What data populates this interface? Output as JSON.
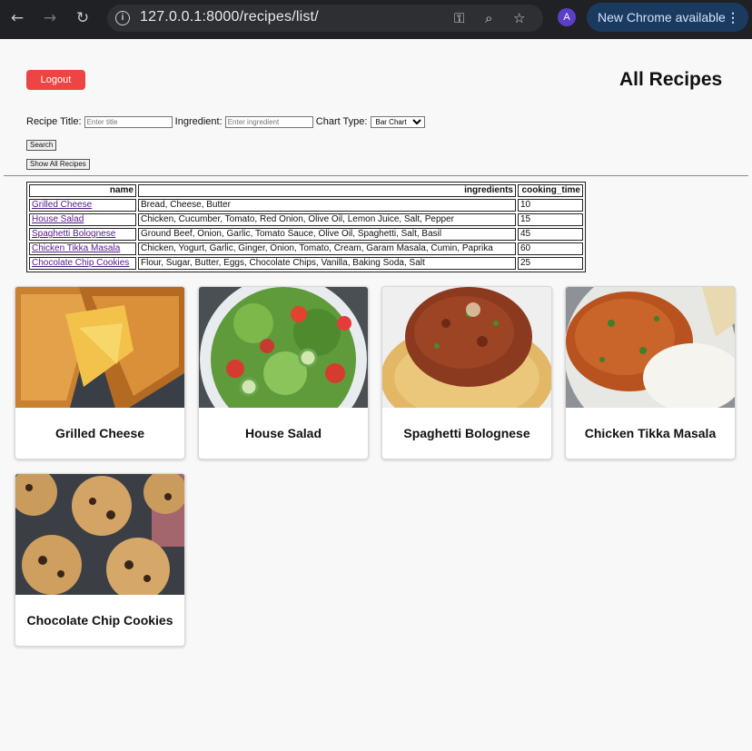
{
  "browser": {
    "url": "127.0.0.1:8000/recipes/list/",
    "avatar_letter": "A",
    "update_label": "New Chrome available",
    "back_icon": "arrow-left-icon",
    "forward_icon": "arrow-right-icon",
    "reload_icon": "reload-icon",
    "info_icon": "info-icon",
    "password_icon": "key-icon",
    "zoom_icon": "zoom-icon",
    "bookmark_icon": "star-icon",
    "menu_icon": "kebab-menu-icon"
  },
  "header": {
    "logout_label": "Logout",
    "title": "All Recipes",
    "logout_color": "#ef4444"
  },
  "search": {
    "title_label": "Recipe Title:",
    "title_placeholder": "Enter title",
    "ingredient_label": "Ingredient:",
    "ingredient_placeholder": "Enter ingredient",
    "chart_label": "Chart Type:",
    "chart_selected": "Bar Chart",
    "search_button": "Search",
    "show_all_button": "Show All Recipes"
  },
  "table": {
    "columns": [
      "name",
      "ingredients",
      "cooking_time"
    ],
    "rows": [
      {
        "name": "Grilled Cheese",
        "ingredients": "Bread, Cheese, Butter",
        "cooking_time": "10"
      },
      {
        "name": "House Salad",
        "ingredients": "Chicken, Cucumber, Tomato, Red Onion, Olive Oil, Lemon Juice, Salt, Pepper",
        "cooking_time": "15"
      },
      {
        "name": "Spaghetti Bolognese",
        "ingredients": "Ground Beef, Onion, Garlic, Tomato Sauce, Olive Oil, Spaghetti, Salt, Basil",
        "cooking_time": "45"
      },
      {
        "name": "Chicken Tikka Masala",
        "ingredients": "Chicken, Yogurt, Garlic, Ginger, Onion, Tomato, Cream, Garam Masala, Cumin, Paprika",
        "cooking_time": "60"
      },
      {
        "name": "Chocolate Chip Cookies",
        "ingredients": "Flour, Sugar, Butter, Eggs, Chocolate Chips, Vanilla, Baking Soda, Salt",
        "cooking_time": "25"
      }
    ]
  },
  "cards": [
    {
      "title": "Grilled Cheese"
    },
    {
      "title": "House Salad"
    },
    {
      "title": "Spaghetti Bolognese"
    },
    {
      "title": "Chicken Tikka Masala"
    },
    {
      "title": "Chocolate Chip Cookies"
    }
  ]
}
